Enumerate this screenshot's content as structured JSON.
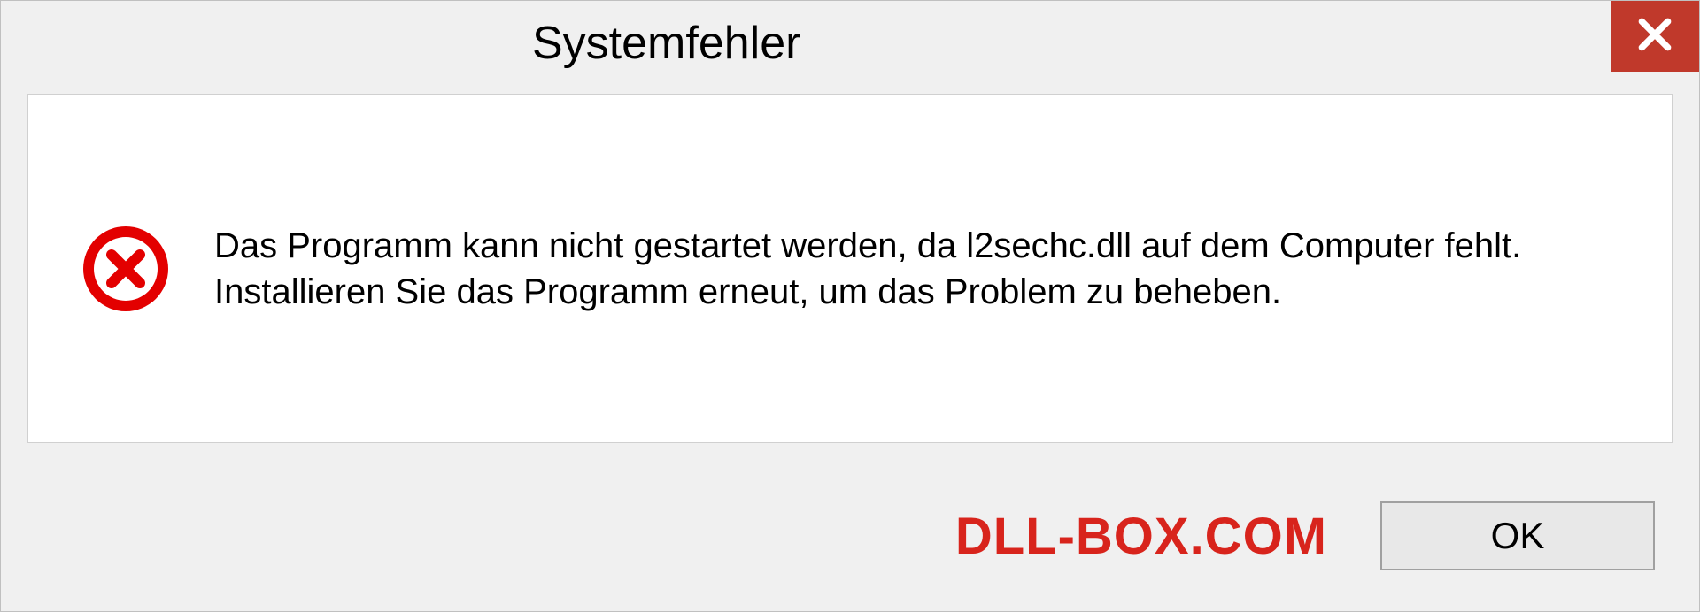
{
  "dialog": {
    "title": "Systemfehler",
    "message": "Das Programm kann nicht gestartet werden, da l2sechc.dll auf dem Computer fehlt. Installieren Sie das Programm erneut, um das Problem zu beheben.",
    "ok_label": "OK"
  },
  "watermark": "DLL-BOX.COM",
  "colors": {
    "close_bg": "#c0392b",
    "watermark": "#d8241c",
    "error_icon": "#e30000"
  }
}
